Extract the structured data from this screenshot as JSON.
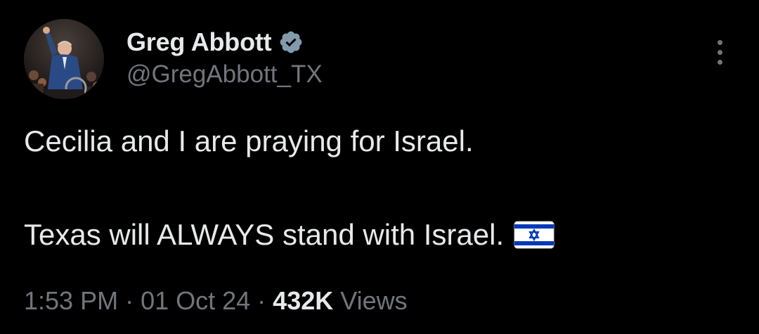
{
  "author": {
    "display_name": "Greg Abbott",
    "handle": "@GregAbbott_TX",
    "verified_icon": "verified-badge-icon",
    "avatar_icon": "avatar-photo"
  },
  "tweet": {
    "line_1": "Cecilia and I are praying for Israel.",
    "line_2": "Texas will ALWAYS stand with Israel.",
    "emoji_icon": "israel-flag-icon"
  },
  "meta": {
    "time": "1:53 PM",
    "separator": "·",
    "date": "01 Oct 24",
    "views_count": "432K",
    "views_label": "Views"
  },
  "more_icon": "more-vertical-icon",
  "colors": {
    "background": "#000000",
    "primary_text": "#e7e9ea",
    "secondary_text": "#71767b",
    "verified_badge": "#829aab",
    "flag_blue": "#0038b8"
  }
}
